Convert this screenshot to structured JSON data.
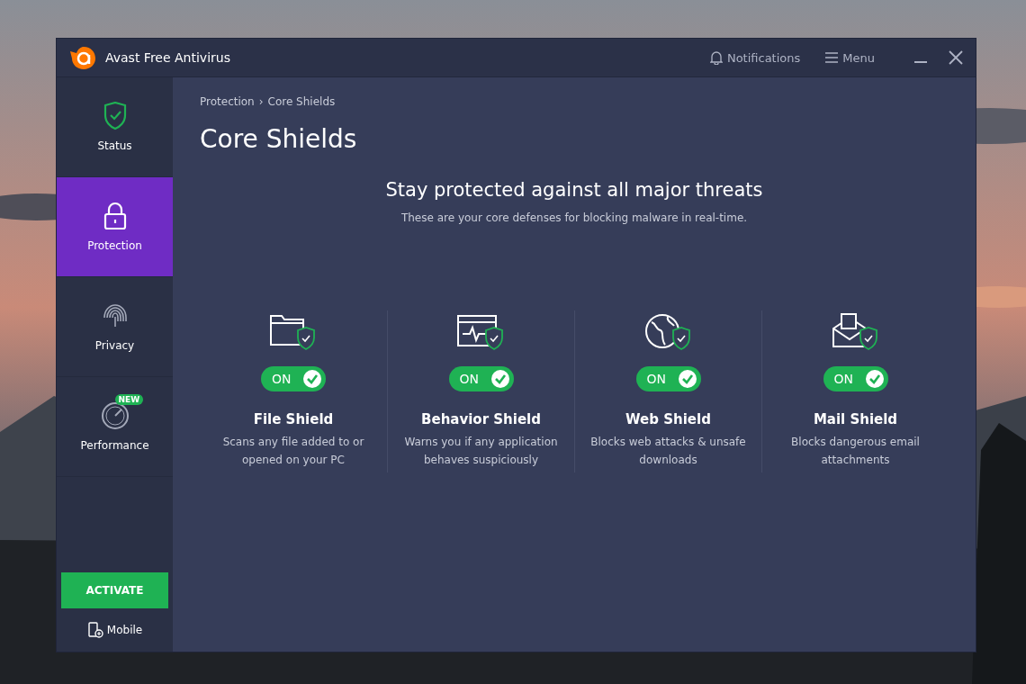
{
  "window": {
    "title": "Avast Free Antivirus"
  },
  "header_actions": [
    {
      "kind": "notifications",
      "label": "Notifications"
    },
    {
      "kind": "menu",
      "label": "Menu"
    }
  ],
  "sidebar": {
    "items": [
      {
        "kind": "status",
        "label": "Status",
        "selected": false
      },
      {
        "kind": "protection",
        "label": "Protection",
        "selected": true
      },
      {
        "kind": "privacy",
        "label": "Privacy",
        "selected": false
      },
      {
        "kind": "performance",
        "label": "Performance",
        "selected": false,
        "badge": "NEW"
      }
    ],
    "activate_button": "ACTIVATE",
    "mobile_link": "Mobile"
  },
  "breadcrumb": {
    "items": [
      "Protection",
      "Core Shields"
    ],
    "separator": "›"
  },
  "page_title": "Core Shields",
  "headline": "Stay protected against all major threats",
  "subtitle": "These are your core defenses for blocking malware in real-time.",
  "shields": [
    {
      "kind": "file",
      "name": "File Shield",
      "on": true,
      "toggle_label": "ON",
      "description": "Scans any file added to or opened on your PC"
    },
    {
      "kind": "behavior",
      "name": "Behavior Shield",
      "on": true,
      "toggle_label": "ON",
      "description": "Warns you if any application behaves suspiciously"
    },
    {
      "kind": "web",
      "name": "Web Shield",
      "on": true,
      "toggle_label": "ON",
      "description": "Blocks web attacks & unsafe downloads"
    },
    {
      "kind": "mail",
      "name": "Mail Shield",
      "on": true,
      "toggle_label": "ON",
      "description": "Blocks dangerous email attachments"
    }
  ]
}
